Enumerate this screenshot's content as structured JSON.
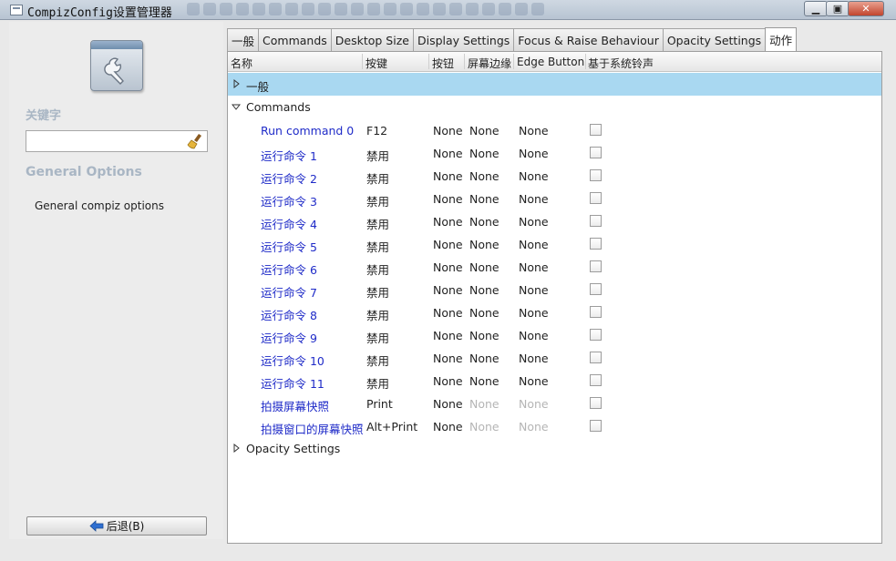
{
  "window": {
    "title": "CompizConfig设置管理器"
  },
  "sidebar": {
    "keyword_label": "关键字",
    "search_value": "",
    "section_title": "General Options",
    "section_item": "General compiz options",
    "back_label": "后退(B)"
  },
  "tabs": [
    "一般",
    "Commands",
    "Desktop Size",
    "Display Settings",
    "Focus & Raise Behaviour",
    "Opacity Settings",
    "动作"
  ],
  "active_tab": "动作",
  "columns": [
    "名称",
    "按键",
    "按钮",
    "屏幕边缘",
    "Edge Button",
    "基于系统铃声"
  ],
  "groups": {
    "general": "一般",
    "commands": "Commands",
    "opacity": "Opacity Settings"
  },
  "rows": [
    {
      "name": "Run command 0",
      "key": "F12",
      "button": "None",
      "edge": "None",
      "edge_button": "None",
      "bell": false,
      "edge_disabled": false
    },
    {
      "name": "运行命令 1",
      "key": "禁用",
      "button": "None",
      "edge": "None",
      "edge_button": "None",
      "bell": false,
      "edge_disabled": false
    },
    {
      "name": "运行命令 2",
      "key": "禁用",
      "button": "None",
      "edge": "None",
      "edge_button": "None",
      "bell": false,
      "edge_disabled": false
    },
    {
      "name": "运行命令 3",
      "key": "禁用",
      "button": "None",
      "edge": "None",
      "edge_button": "None",
      "bell": false,
      "edge_disabled": false
    },
    {
      "name": "运行命令 4",
      "key": "禁用",
      "button": "None",
      "edge": "None",
      "edge_button": "None",
      "bell": false,
      "edge_disabled": false
    },
    {
      "name": "运行命令 5",
      "key": "禁用",
      "button": "None",
      "edge": "None",
      "edge_button": "None",
      "bell": false,
      "edge_disabled": false
    },
    {
      "name": "运行命令 6",
      "key": "禁用",
      "button": "None",
      "edge": "None",
      "edge_button": "None",
      "bell": false,
      "edge_disabled": false
    },
    {
      "name": "运行命令 7",
      "key": "禁用",
      "button": "None",
      "edge": "None",
      "edge_button": "None",
      "bell": false,
      "edge_disabled": false
    },
    {
      "name": "运行命令 8",
      "key": "禁用",
      "button": "None",
      "edge": "None",
      "edge_button": "None",
      "bell": false,
      "edge_disabled": false
    },
    {
      "name": "运行命令 9",
      "key": "禁用",
      "button": "None",
      "edge": "None",
      "edge_button": "None",
      "bell": false,
      "edge_disabled": false
    },
    {
      "name": "运行命令 10",
      "key": "禁用",
      "button": "None",
      "edge": "None",
      "edge_button": "None",
      "bell": false,
      "edge_disabled": false
    },
    {
      "name": "运行命令 11",
      "key": "禁用",
      "button": "None",
      "edge": "None",
      "edge_button": "None",
      "bell": false,
      "edge_disabled": false
    },
    {
      "name": "拍摄屏幕快照",
      "key": "Print",
      "button": "None",
      "edge": "None",
      "edge_button": "None",
      "bell": false,
      "edge_disabled": true
    },
    {
      "name": "拍摄窗口的屏幕快照",
      "key": "Alt+Print",
      "button": "None",
      "edge": "None",
      "edge_button": "None",
      "bell": false,
      "edge_disabled": true
    }
  ],
  "colors": {
    "selected_row": "#a9d8f1",
    "link_text": "#1f2bc8",
    "section_heading": "#a9b6c4"
  },
  "icons": [
    "app-icon",
    "settings-wrench-icon",
    "clear-brush-icon",
    "back-arrow-icon",
    "expander-icon",
    "minimize-icon",
    "maximize-icon",
    "close-icon"
  ]
}
